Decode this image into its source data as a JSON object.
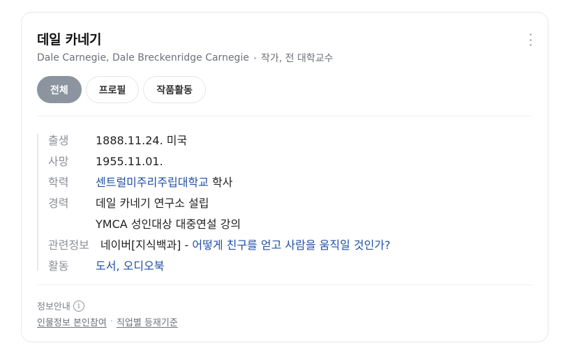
{
  "person": {
    "name": "데일 카네기",
    "aliases": "Dale Carnegie, Dale Breckenridge Carnegie",
    "occupation": "작가, 전 대학교수"
  },
  "tabs": [
    {
      "label": "전체",
      "active": true
    },
    {
      "label": "프로필",
      "active": false
    },
    {
      "label": "작품활동",
      "active": false
    }
  ],
  "profile": {
    "birth": {
      "label": "출생",
      "value": "1888.11.24. 미국"
    },
    "death": {
      "label": "사망",
      "value": "1955.11.01."
    },
    "education": {
      "label": "학력",
      "link": "센트럴미주리주립대학교",
      "suffix": " 학사"
    },
    "career": {
      "label": "경력",
      "items": [
        "데일 카네기 연구소 설립",
        "YMCA 성인대상 대중연설 강의"
      ]
    },
    "related": {
      "label": "관련정보",
      "source": "네이버[지식백과]",
      "dash": " - ",
      "link": "어떻게 친구를 얻고 사람을 움직일 것인가?"
    },
    "activity": {
      "label": "활동",
      "link1": "도서",
      "comma": ", ",
      "link2": "오디오북"
    }
  },
  "footer": {
    "notice": "정보안내",
    "info_icon": "info-circle-icon",
    "link1": "인물정보 본인참여",
    "separator": "·",
    "link2": "직업별 등재기준"
  },
  "colors": {
    "active_tab": "#8b949f",
    "link": "#1f4ea6",
    "label": "#8b8f97"
  }
}
